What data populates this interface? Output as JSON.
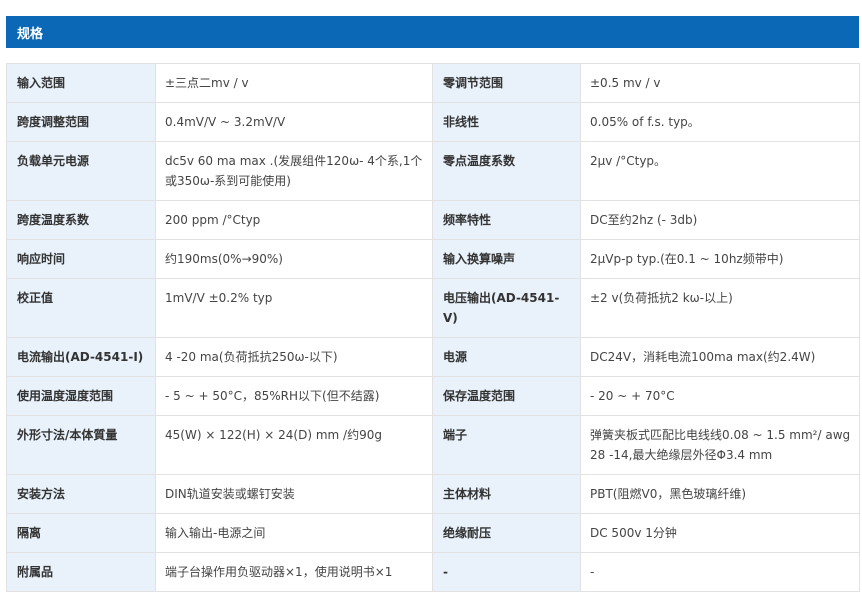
{
  "header": {
    "title": "规格",
    "bg_color": "#0a68b6"
  },
  "rows": [
    {
      "label1": "输入范围",
      "value1": "±三点二mv / v",
      "label2": "零调节范围",
      "value2": "±0.5 mv / v"
    },
    {
      "label1": "跨度调整范围",
      "value1": "0.4mV/V ~ 3.2mV/V",
      "label2": "非线性",
      "value2": "0.05% of f.s. typ。"
    },
    {
      "label1": "负载单元电源",
      "value1": "dc5v 60 ma max .(发展组件120ω- 4个系,1个或350ω-系到可能使用)",
      "label2": "零点温度系数",
      "value2": "2μv /°Ctyp。"
    },
    {
      "label1": "跨度温度系数",
      "value1": "200 ppm /°Ctyp",
      "label2": "频率特性",
      "value2": "DC至约2hz (- 3db)"
    },
    {
      "label1": "响应时间",
      "value1": "约190ms(0%→90%)",
      "label2": "输入换算噪声",
      "value2": "2μVp-p typ.(在0.1 ~ 10hz频带中)"
    },
    {
      "label1": "校正值",
      "value1": "1mV/V ±0.2% typ",
      "label2": "电压输出(AD-4541-V)",
      "value2": "±2 v(负荷抵抗2 kω-以上)"
    },
    {
      "label1": "电流输出(AD-4541-I)",
      "value1": "4 -20 ma(负荷抵抗250ω-以下)",
      "label2": "电源",
      "value2": "DC24V，消耗电流100ma max(约2.4W)"
    },
    {
      "label1": "使用温度湿度范围",
      "value1": "- 5 ~ + 50°C，85%RH以下(但不结露)",
      "label2": "保存温度范围",
      "value2": "- 20 ~ + 70°C"
    },
    {
      "label1": "外形寸法/本体質量",
      "value1": "45(W) × 122(H) × 24(D) mm /约90g",
      "label2": "端子",
      "value2": "弹簧夹板式匹配比电线线0.08 ~ 1.5 mm²/ awg 28 -14,最大绝缘层外径Φ3.4 mm"
    },
    {
      "label1": "安装方法",
      "value1": "DIN轨道安装或螺钉安装",
      "label2": "主体材料",
      "value2": "PBT(阻燃V0，黑色玻璃纤维)"
    },
    {
      "label1": "隔离",
      "value1": "输入输出-电源之间",
      "label2": "绝缘耐压",
      "value2": "DC 500v 1分钟"
    },
    {
      "label1": "附属品",
      "value1": "端子台操作用负驱动器×1，使用说明书×1",
      "label2": "-",
      "value2": "-"
    }
  ]
}
